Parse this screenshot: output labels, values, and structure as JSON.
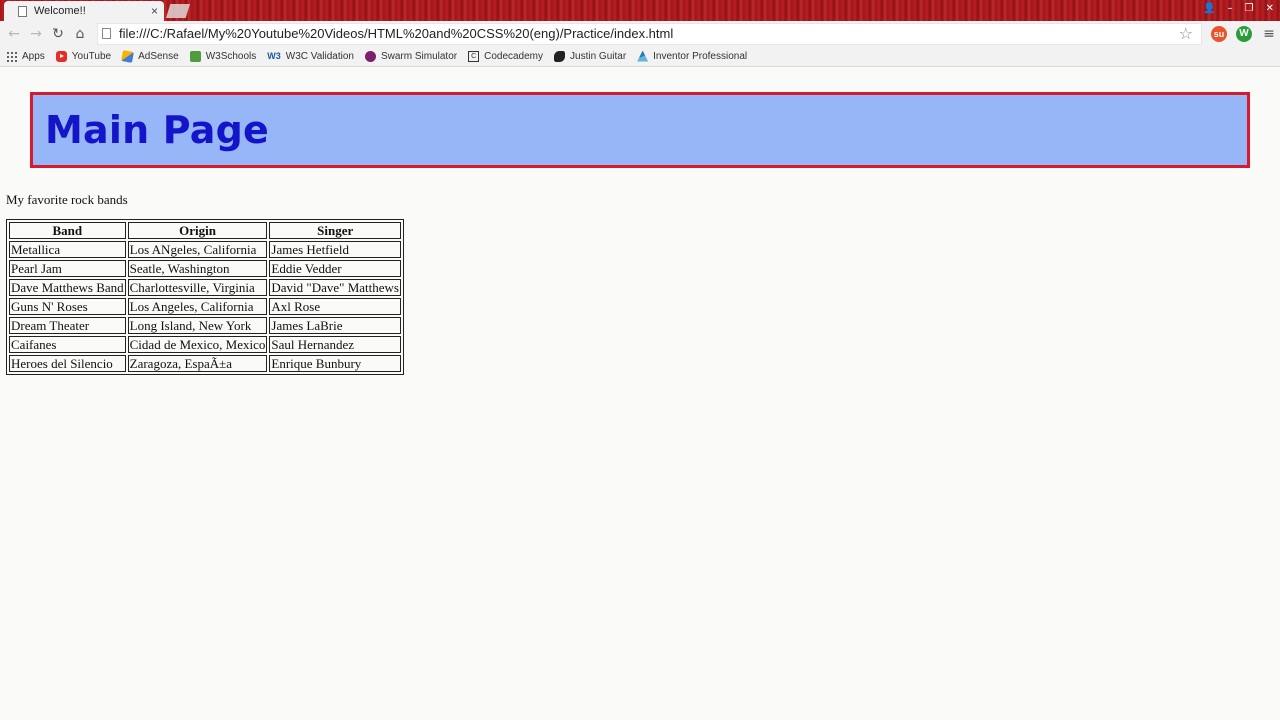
{
  "browser": {
    "tab": {
      "title": "Welcome!!",
      "close": "×"
    },
    "window_controls": {
      "user": "👤",
      "minimize": "–",
      "restore": "❐",
      "close": "✕"
    },
    "toolbar": {
      "back": "←",
      "forward": "→",
      "reload": "↻",
      "home": "⌂",
      "url": "file:///C:/Rafael/My%20Youtube%20Videos/HTML%20and%20CSS%20(eng)/Practice/index.html",
      "star": "☆",
      "menu": "≡"
    },
    "extensions": [
      {
        "label": "su"
      },
      {
        "label": "W"
      }
    ],
    "bookmarks": [
      {
        "label": "Apps",
        "icon": "apps-grid-icon"
      },
      {
        "label": "YouTube",
        "icon": "youtube-icon"
      },
      {
        "label": "AdSense",
        "icon": "adsense-icon"
      },
      {
        "label": "W3Schools",
        "icon": "w3schools-icon"
      },
      {
        "label": "W3C Validation",
        "icon": "w3c-icon"
      },
      {
        "label": "Swarm Simulator",
        "icon": "swarm-icon"
      },
      {
        "label": "Codecademy",
        "icon": "codecademy-icon"
      },
      {
        "label": "Justin Guitar",
        "icon": "justin-guitar-icon"
      },
      {
        "label": "Inventor Professional",
        "icon": "inventor-icon"
      }
    ]
  },
  "page": {
    "heading": "Main Page",
    "intro": "My favorite rock bands",
    "table": {
      "headers": [
        "Band",
        "Origin",
        "Singer"
      ],
      "rows": [
        [
          "Metallica",
          "Los ANgeles, California",
          "James Hetfield"
        ],
        [
          "Pearl Jam",
          "Seatle, Washington",
          "Eddie Vedder"
        ],
        [
          "Dave Matthews Band",
          "Charlottesville, Virginia",
          "David \"Dave\" Matthews"
        ],
        [
          "Guns N' Roses",
          "Los Angeles, California",
          "Axl Rose"
        ],
        [
          "Dream Theater",
          "Long Island, New York",
          "James LaBrie"
        ],
        [
          "Caifanes",
          "Cidad de Mexico, Mexico",
          "Saul Hernandez"
        ],
        [
          "Heroes del Silencio",
          "Zaragoza, EspaÃ±a",
          "Enrique Bunbury"
        ]
      ]
    }
  },
  "colors": {
    "header_bg": "#97b6f7",
    "header_border": "#d41c2c",
    "heading_text": "#1414c8"
  }
}
